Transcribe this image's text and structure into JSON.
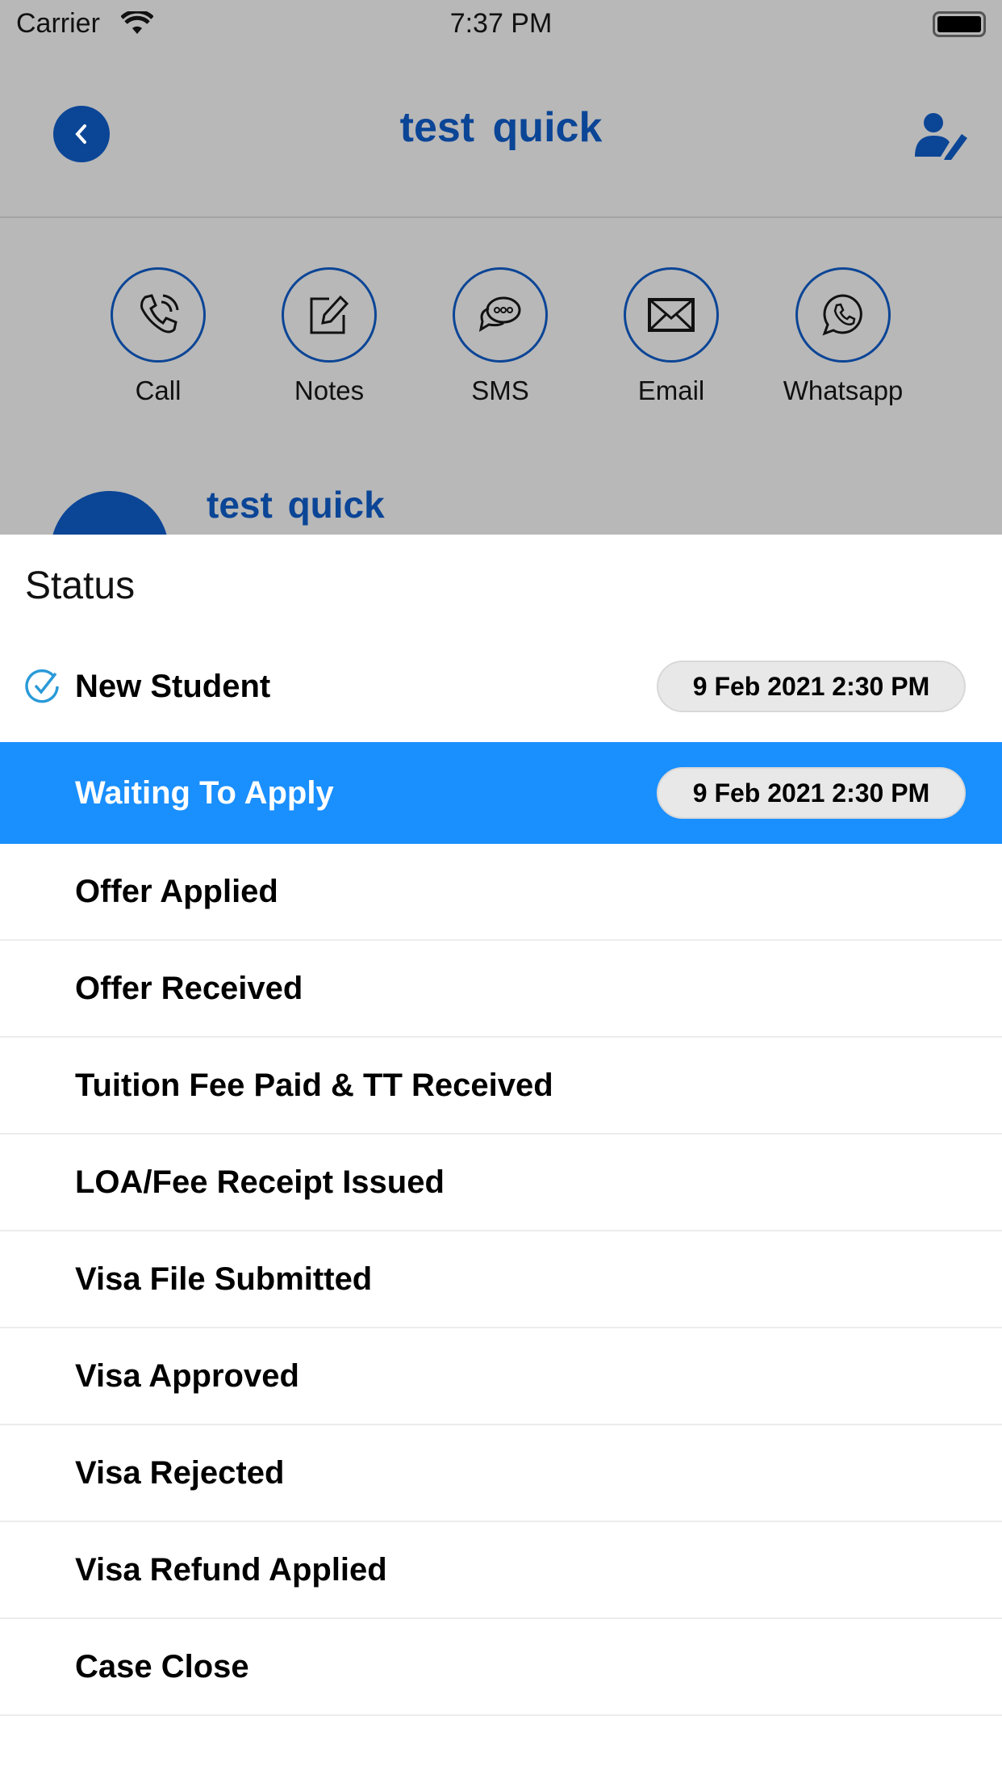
{
  "status_bar": {
    "carrier": "Carrier",
    "time": "7:37 PM"
  },
  "header": {
    "title": "test  quick"
  },
  "actions": [
    {
      "label": "Call",
      "icon": "phone-icon"
    },
    {
      "label": "Notes",
      "icon": "notes-icon"
    },
    {
      "label": "SMS",
      "icon": "chat-icon"
    },
    {
      "label": "Email",
      "icon": "envelope-icon"
    },
    {
      "label": "Whatsapp",
      "icon": "whatsapp-icon"
    }
  ],
  "profile": {
    "name": "test  quick"
  },
  "sheet": {
    "title": "Status",
    "items": [
      {
        "label": "New Student",
        "date": "9 Feb 2021 2:30 PM",
        "checked": true
      },
      {
        "label": "Waiting To Apply",
        "date": "9 Feb 2021 2:30 PM",
        "selected": true
      },
      {
        "label": "Offer Applied"
      },
      {
        "label": "Offer Received"
      },
      {
        "label": "Tuition Fee Paid & TT Received"
      },
      {
        "label": "LOA/Fee Receipt Issued"
      },
      {
        "label": "Visa File Submitted"
      },
      {
        "label": "Visa Approved"
      },
      {
        "label": "Visa Rejected"
      },
      {
        "label": "Visa Refund Applied"
      },
      {
        "label": "Case Close"
      }
    ]
  },
  "colors": {
    "brand": "#0b4596",
    "selected": "#1a8ffe",
    "check": "#2a9ad8"
  }
}
